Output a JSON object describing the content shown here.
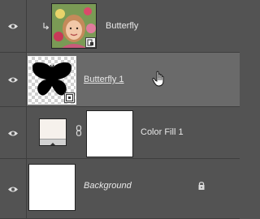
{
  "layers": [
    {
      "name": "Butterfly",
      "visible": true,
      "clipped": true,
      "type": "smart-object-image"
    },
    {
      "name": "Butterfly 1",
      "visible": true,
      "selected": true,
      "type": "smart-object-shape"
    },
    {
      "name": "Color Fill 1",
      "visible": true,
      "type": "fill-layer",
      "fill_color": "#f6f1ec"
    },
    {
      "name": "Background",
      "visible": true,
      "locked": true,
      "type": "background"
    }
  ],
  "colors": {
    "panel_bg": "#535353",
    "selected_bg": "#6a6a6a",
    "divider": "#3e3e3e"
  }
}
